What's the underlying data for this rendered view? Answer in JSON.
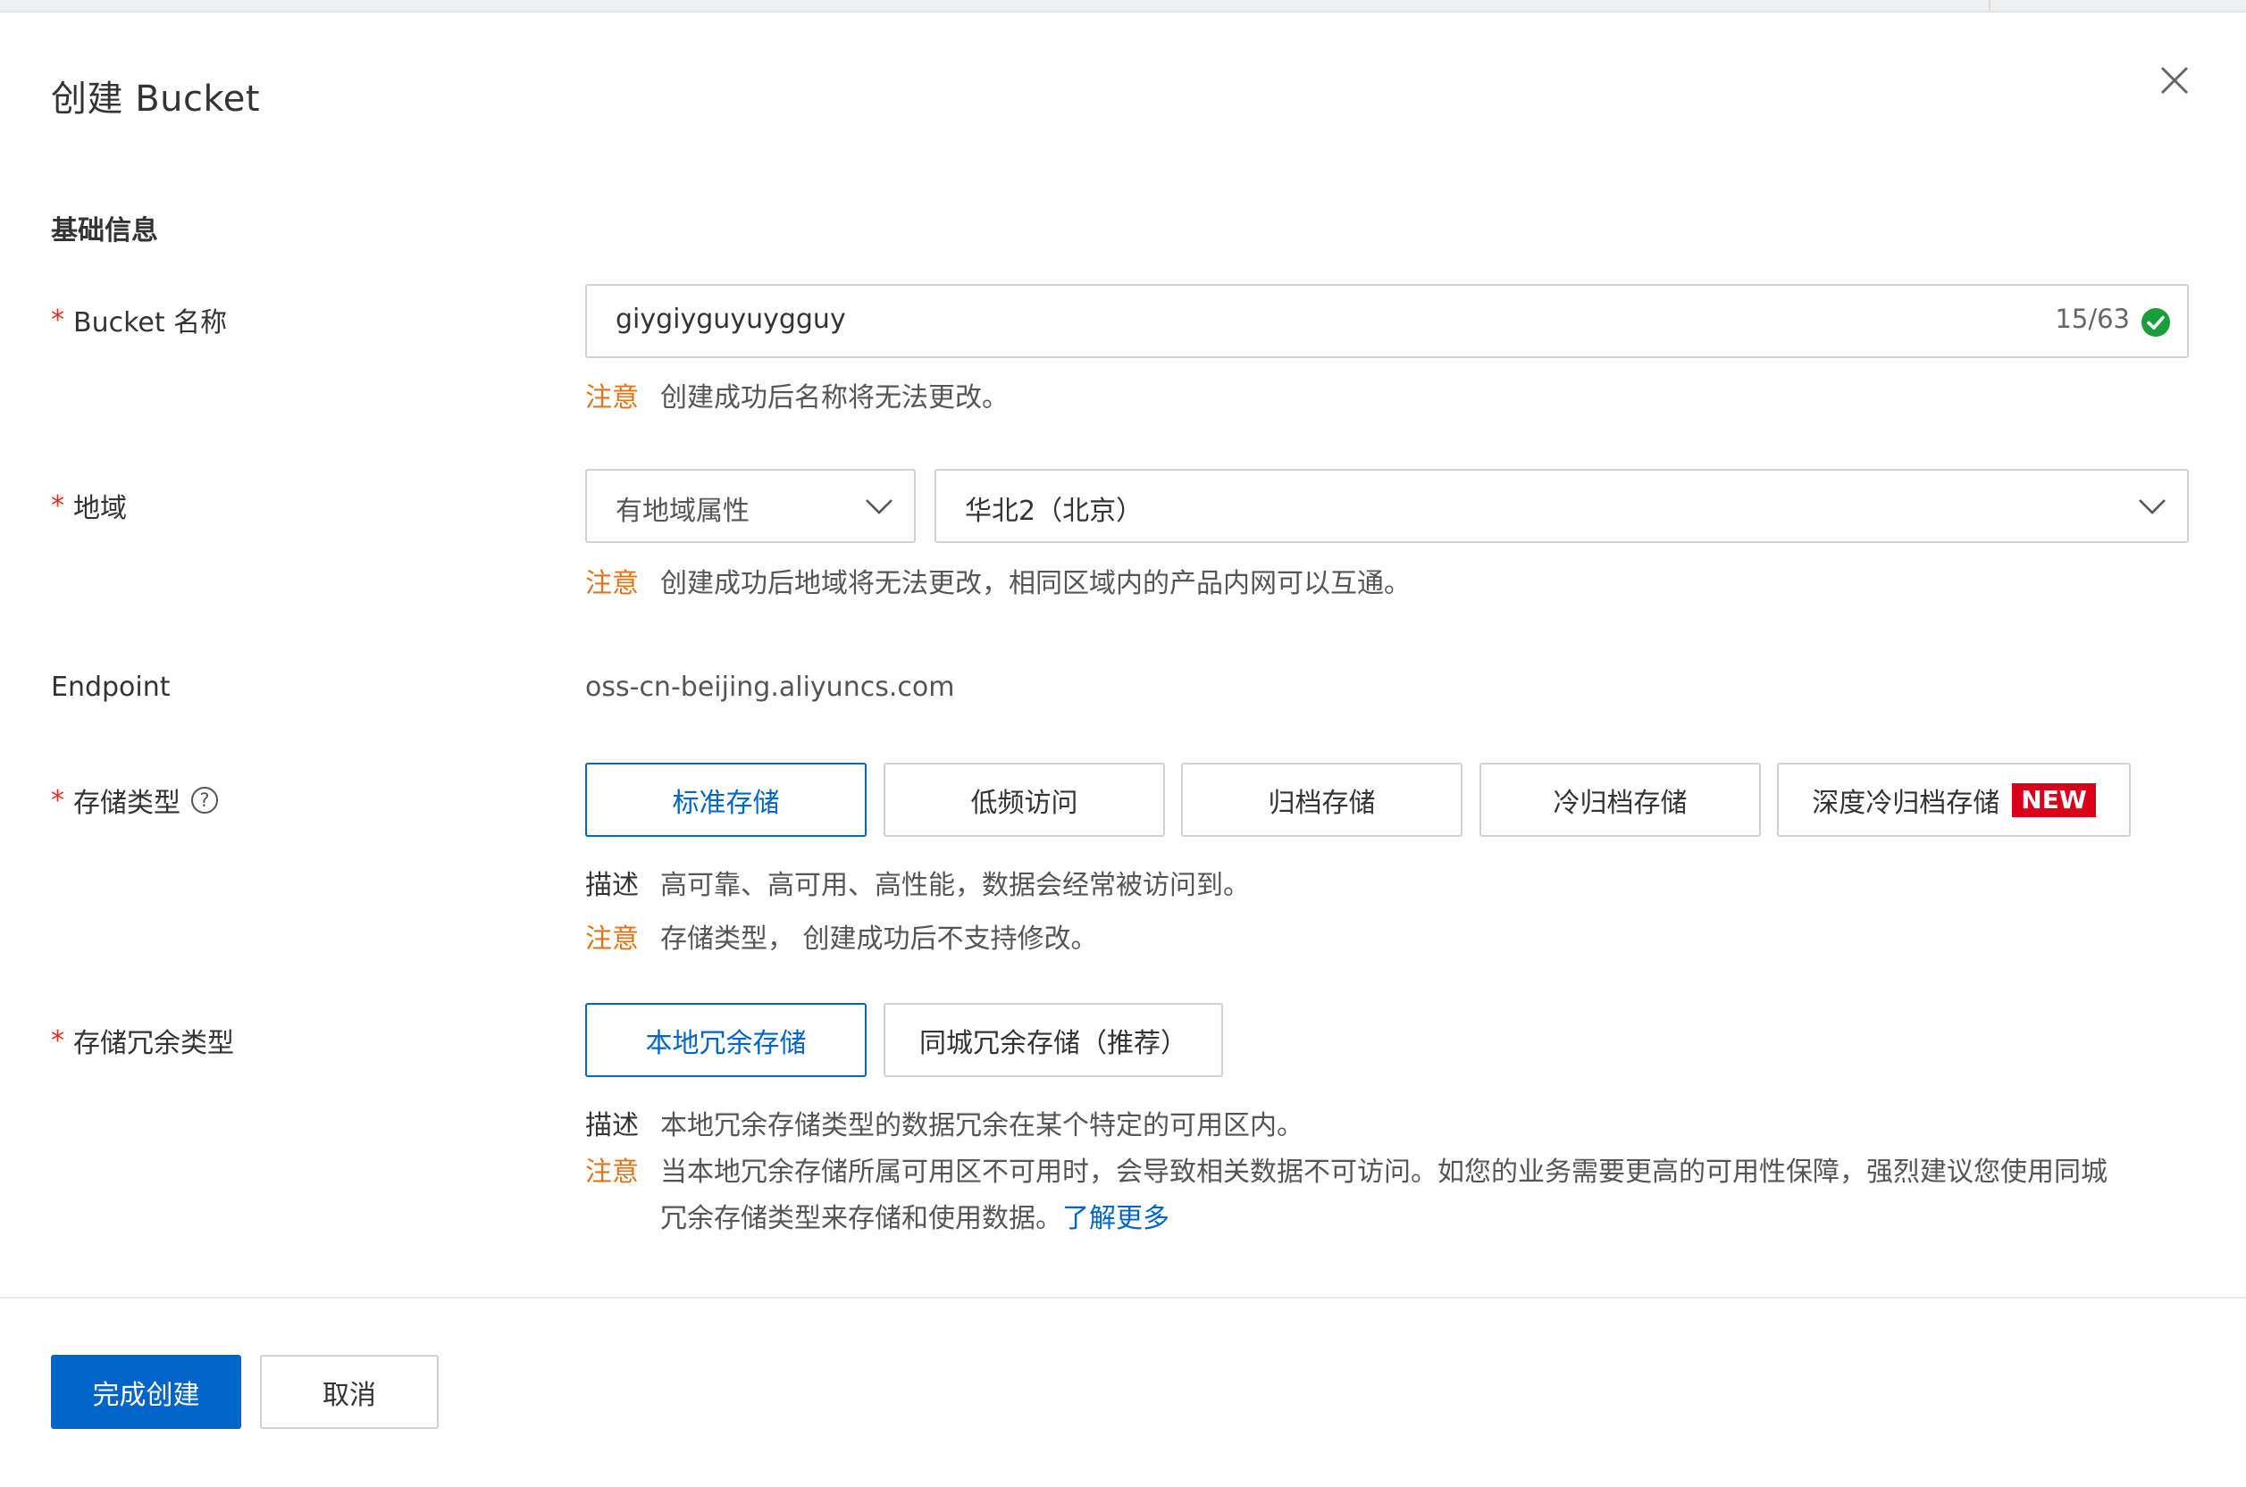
{
  "dialog": {
    "title": "创建 Bucket",
    "close_icon": "close-icon"
  },
  "section": {
    "basic_info": "基础信息"
  },
  "bucket_name": {
    "required": "*",
    "label": "Bucket 名称",
    "value": "giygiyguyuygguy",
    "counter": "15/63",
    "valid_icon": "check-circle-icon",
    "note_key": "注意",
    "note_text": "创建成功后名称将无法更改。"
  },
  "region": {
    "required": "*",
    "label": "地域",
    "type_select": "有地域属性",
    "region_select": "华北2（北京）",
    "note_key": "注意",
    "note_text": "创建成功后地域将无法更改，相同区域内的产品内网可以互通。"
  },
  "endpoint": {
    "label": "Endpoint",
    "value": "oss-cn-beijing.aliyuncs.com"
  },
  "storage_class": {
    "required": "*",
    "label": "存储类型",
    "help_icon": "?",
    "options": [
      {
        "label": "标准存储",
        "selected": true
      },
      {
        "label": "低频访问",
        "selected": false
      },
      {
        "label": "归档存储",
        "selected": false
      },
      {
        "label": "冷归档存储",
        "selected": false
      },
      {
        "label": "深度冷归档存储",
        "selected": false,
        "badge": "NEW"
      }
    ],
    "desc_key": "描述",
    "desc_text": "高可靠、高可用、高性能，数据会经常被访问到。",
    "note_key": "注意",
    "note_text": "存储类型， 创建成功后不支持修改。"
  },
  "redundancy": {
    "required": "*",
    "label": "存储冗余类型",
    "options": [
      {
        "label": "本地冗余存储",
        "selected": true
      },
      {
        "label": "同城冗余存储（推荐）",
        "selected": false
      }
    ],
    "desc_key": "描述",
    "desc_text": "本地冗余存储类型的数据冗余在某个特定的可用区内。",
    "note_key": "注意",
    "note_line1": "当本地冗余存储所属可用区不可用时，会导致相关数据不可访问。如您的业务需要更高的可用性保障，强烈建议您使用同城",
    "note_line2": "冗余存储类型来存储和使用数据。",
    "learn_more": "了解更多"
  },
  "footer": {
    "submit": "完成创建",
    "cancel": "取消"
  },
  "colors": {
    "primary": "#0064c8",
    "warning": "#e37318",
    "required": "#d93026",
    "badge": "#d9001b",
    "success": "#1a9e3a"
  }
}
